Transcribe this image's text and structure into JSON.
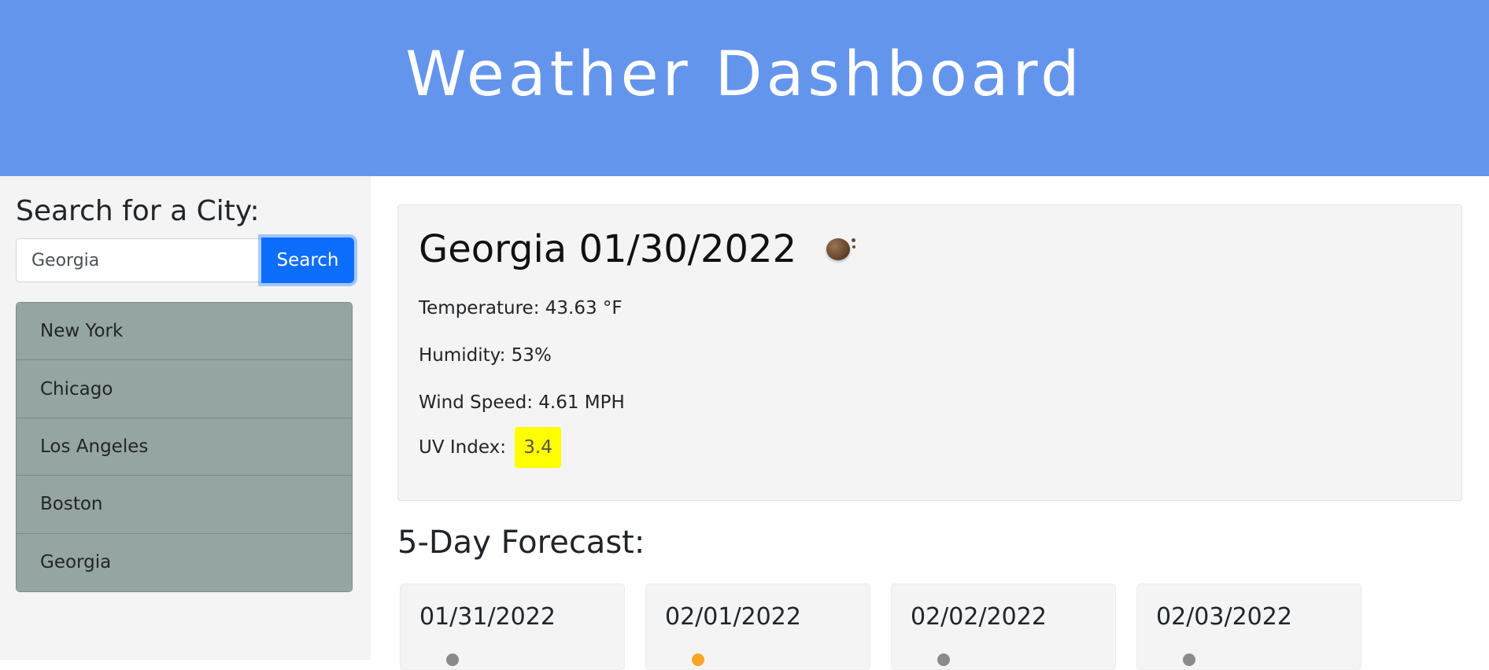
{
  "header": {
    "title": "Weather Dashboard"
  },
  "sidebar": {
    "heading": "Search for a City:",
    "search_value": "Georgia",
    "search_button": "Search",
    "cities": [
      "New York",
      "Chicago",
      "Los Angeles",
      "Boston",
      "Georgia"
    ]
  },
  "current": {
    "title": "Georgia 01/30/2022",
    "icon": "weather-icon",
    "temperature": "Temperature: 43.63 °F",
    "humidity": "Humidity: 53%",
    "wind": "Wind Speed: 4.61 MPH",
    "uv_label": "UV Index:",
    "uv_value": "3.4",
    "uv_color": "#ffff00"
  },
  "forecast": {
    "title": "5-Day Forecast:",
    "days": [
      {
        "date": "01/31/2022",
        "icon": "cloud-icon"
      },
      {
        "date": "02/01/2022",
        "icon": "sun-icon"
      },
      {
        "date": "02/02/2022",
        "icon": "cloud-icon"
      },
      {
        "date": "02/03/2022",
        "icon": "cloud-icon"
      }
    ]
  },
  "colors": {
    "header_bg": "#6495ed",
    "button": "#0d6efd",
    "city_item": "#95a5a3"
  }
}
